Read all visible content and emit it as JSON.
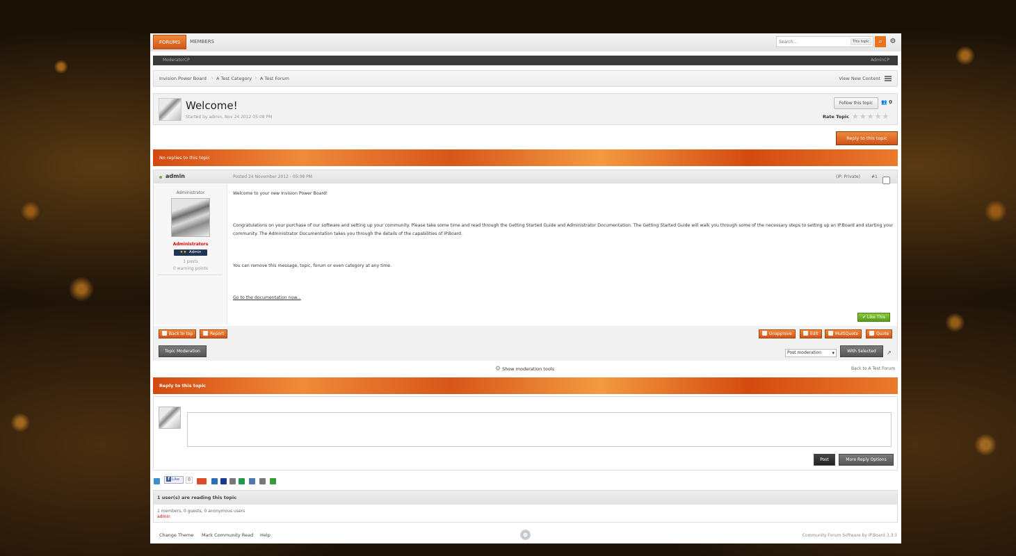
{
  "header": {
    "tabs": [
      {
        "label": "FORUMS"
      },
      {
        "label": "MEMBERS"
      }
    ],
    "search_placeholder": "Search...",
    "search_scope": "This topic"
  },
  "modbar": {
    "left": "ModeratorCP",
    "right": "AdminCP"
  },
  "breadcrumb": [
    "Invision Power Board",
    "A Test Category",
    "A Test Forum"
  ],
  "view_new_content": "View New Content",
  "topic": {
    "title": "Welcome!",
    "meta": "Started by admin, Nov 24 2012 05:08 PM",
    "follow_label": "Follow this topic",
    "followers": "0",
    "rate_label": "Rate Topic",
    "rating": 0,
    "reply_label": "Reply to this topic",
    "no_replies": "No replies to this topic"
  },
  "post": {
    "author": "admin",
    "date": "Posted 24 November 2012 - 05:08 PM",
    "ip": "(IP: Private)",
    "number": "#1",
    "author_title": "Administrator",
    "group": "Administrators",
    "rank": "Admin",
    "posts": "1 posts",
    "warnings": "0 warning points",
    "paragraphs": [
      "Welcome to your new Invision Power Board!",
      "Congratulations on your purchase of our software and setting up your community.  Please take some time and read through the Getting Started Guide and Administrator Documentation.  The Getting Started Guide will walk you through some of the necessary steps to setting up an IP.Board and starting your community. The Administrator Documentation takes you through the details of the capabilities of IP.Board.",
      "You can remove this message, topic, forum or even category at any time.",
      "Go to the documentation now..."
    ],
    "like_label": "Like This",
    "back_to_top": "Back to top",
    "report": "Report",
    "unapprove": "Unapprove",
    "edit": "Edit",
    "multiquote": "MultiQuote",
    "quote": "Quote",
    "topic_moderation": "Topic Moderation",
    "post_moderation": "Post moderation",
    "with_selected": "With Selected"
  },
  "show_mod_tools": "Show moderation tools",
  "back_to_forum": "Back to A Test Forum",
  "reply": {
    "title": "Reply to this topic",
    "post_label": "Post",
    "more_options": "More Reply Options"
  },
  "share": {
    "fb_like": "Like",
    "fb_count": "0",
    "colors": [
      "#3a8fd0",
      "#e04a2a",
      "#2c6fb0",
      "#1a3c8a",
      "#777777",
      "#1e9a4a",
      "#4a7ab0",
      "#777777",
      "#3a9a3a"
    ]
  },
  "readers": {
    "title": "1 user(s) are reading this topic",
    "counts": "1 members, 0 guests, 0 anonymous users",
    "names": "admin"
  },
  "footer": {
    "change_theme": "Change Theme",
    "mark_read": "Mark Community Read",
    "help": "Help",
    "copyright": "Community Forum Software by IP.Board 3.3.3"
  }
}
